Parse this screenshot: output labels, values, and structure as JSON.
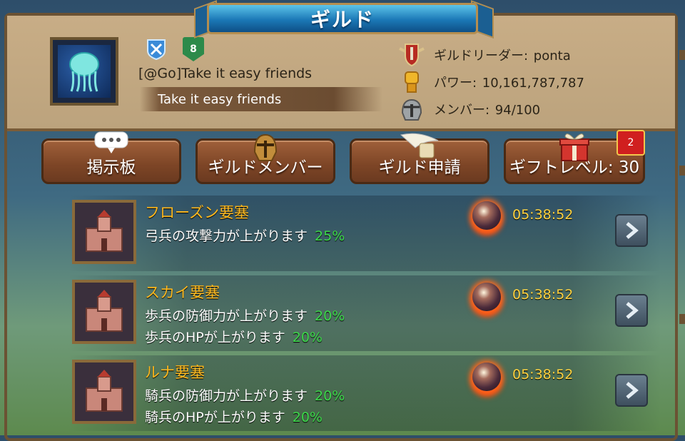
{
  "header": {
    "title": "ギルド",
    "guild_name": "[@Go]Take it easy friends",
    "motto": "Take it easy friends",
    "level_badge": "8",
    "leader_label": "ギルドリーダー: ",
    "leader_value": "ponta",
    "power_label": "パワー: ",
    "power_value": "10,161,787,787",
    "members_label": "メンバー: ",
    "members_value": "94/100",
    "icons": {
      "emblem": "jellyfish-emblem-icon",
      "rank": "crossed-swords-shield-icon",
      "leader": "leader-shield-icon",
      "power": "power-fist-icon",
      "members": "helmet-icon"
    }
  },
  "tabs": [
    {
      "label": "掲示板",
      "icon": "speech-bubble-icon"
    },
    {
      "label": "ギルドメンバー",
      "icon": "helmet-icon"
    },
    {
      "label": "ギルド申請",
      "icon": "quill-scroll-icon"
    },
    {
      "label": "ギフトレベル: 30",
      "icon": "gift-box-icon"
    }
  ],
  "gift_notification": "2",
  "fortresses": [
    {
      "name": "フローズン要塞",
      "time": "05:38:52",
      "effects": [
        {
          "text": "弓兵の攻撃力が上がります",
          "value": "25%"
        }
      ]
    },
    {
      "name": "スカイ要塞",
      "time": "05:38:52",
      "effects": [
        {
          "text": "歩兵の防御力が上がります",
          "value": "20%"
        },
        {
          "text": "歩兵のHPが上がります",
          "value": "20%"
        }
      ]
    },
    {
      "name": "ルナ要塞",
      "time": "05:38:52",
      "effects": [
        {
          "text": "騎兵の防御力が上がります",
          "value": "20%"
        },
        {
          "text": "騎兵のHPが上がります",
          "value": "20%"
        }
      ]
    }
  ],
  "colors": {
    "title_banner": "#1b78b6",
    "header_bg": "#c8ad86",
    "tab_button": "#7d4526",
    "fortress_title": "#ffb91e",
    "percent": "#3cd94a",
    "timer": "#ffd23f"
  }
}
